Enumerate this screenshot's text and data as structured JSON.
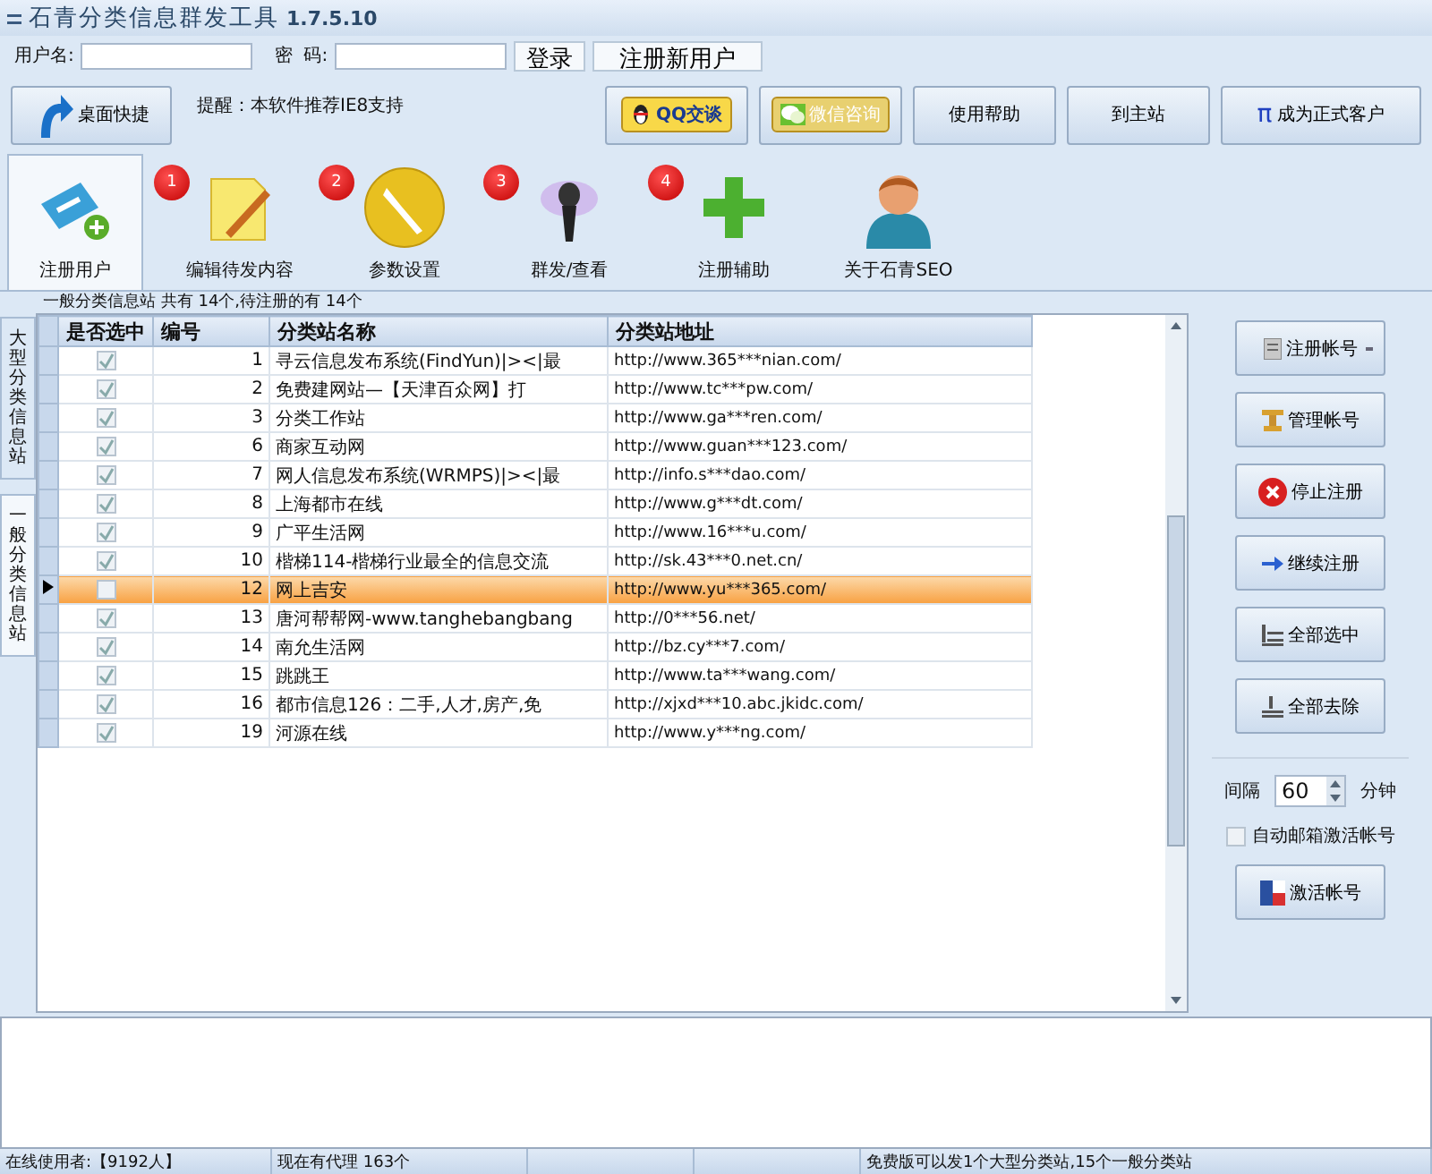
{
  "window": {
    "title": "石青分类信息群发工具",
    "version": "1.7.5.10"
  },
  "login": {
    "username_label": "用户名:",
    "password_label": "密  码:",
    "login_button": "登录",
    "register_button": "注册新用户"
  },
  "toolbar": {
    "shortcut_button": "桌面快捷",
    "notice": "提醒：本软件推荐IE8支持",
    "buttons": [
      {
        "kind": "qq",
        "label": "QQ交谈"
      },
      {
        "kind": "wechat",
        "label": "微信咨询"
      },
      {
        "kind": "plain",
        "label": "使用帮助"
      },
      {
        "kind": "plain",
        "label": "到主站"
      },
      {
        "kind": "pi",
        "icon_text": "π",
        "label": "成为正式客户"
      }
    ]
  },
  "tabs": [
    {
      "kind": "tag",
      "label": "注册用户",
      "selected": true
    },
    {
      "kind": "note",
      "label": "编辑待发内容",
      "selected": false,
      "badge": "1"
    },
    {
      "kind": "wrench",
      "label": "参数设置",
      "selected": false,
      "badge": "2"
    },
    {
      "kind": "mic",
      "label": "群发/查看",
      "selected": false,
      "badge": "3"
    },
    {
      "kind": "plus",
      "label": "注册辅助",
      "selected": false,
      "badge": "4"
    },
    {
      "kind": "person",
      "label": "关于石青SEO",
      "selected": false
    }
  ],
  "side_tabs": [
    {
      "label": "大型分类信息站",
      "selected": false
    },
    {
      "label": "一般分类信息站",
      "selected": true
    }
  ],
  "group_title": "一般分类信息站 共有 14个,待注册的有 14个",
  "table": {
    "columns": [
      "是否选中",
      "编号",
      "分类站名称",
      "分类站地址"
    ],
    "rows": [
      {
        "checked": true,
        "selected": false,
        "number": "1",
        "name": "寻云信息发布系统(FindYun)|><|最",
        "url": "http://www.365***nian.com/"
      },
      {
        "checked": true,
        "selected": false,
        "number": "2",
        "name": "免费建网站—【天津百众网】打",
        "url": "http://www.tc***pw.com/"
      },
      {
        "checked": true,
        "selected": false,
        "number": "3",
        "name": "分类工作站",
        "url": "http://www.ga***ren.com/"
      },
      {
        "checked": true,
        "selected": false,
        "number": "6",
        "name": "商家互动网",
        "url": "http://www.guan***123.com/"
      },
      {
        "checked": true,
        "selected": false,
        "number": "7",
        "name": "网人信息发布系统(WRMPS)|><|最",
        "url": "http://info.s***dao.com/"
      },
      {
        "checked": true,
        "selected": false,
        "number": "8",
        "name": "上海都市在线",
        "url": "http://www.g***dt.com/"
      },
      {
        "checked": true,
        "selected": false,
        "number": "9",
        "name": "广平生活网",
        "url": "http://www.16***u.com/"
      },
      {
        "checked": true,
        "selected": false,
        "number": "10",
        "name": "楷梯114-楷梯行业最全的信息交流",
        "url": "http://sk.43***0.net.cn/"
      },
      {
        "checked": false,
        "selected": true,
        "number": "12",
        "name": "网上吉安",
        "url": "http://www.yu***365.com/"
      },
      {
        "checked": true,
        "selected": false,
        "number": "13",
        "name": "唐河帮帮网-www.tanghebangbang",
        "url": "http://0***56.net/"
      },
      {
        "checked": true,
        "selected": false,
        "number": "14",
        "name": "南允生活网",
        "url": "http://bz.cy***7.com/"
      },
      {
        "checked": true,
        "selected": false,
        "number": "15",
        "name": "跳跳王",
        "url": "http://www.ta***wang.com/"
      },
      {
        "checked": true,
        "selected": false,
        "number": "16",
        "name": "都市信息126：二手,人才,房产,免",
        "url": "http://xjxd***10.abc.jkidc.com/"
      },
      {
        "checked": true,
        "selected": false,
        "number": "19",
        "name": "河源在线",
        "url": "http://www.y***ng.com/"
      }
    ]
  },
  "actions": [
    {
      "kind": "register",
      "label": "注册帐号",
      "dropdown": true
    },
    {
      "kind": "manage",
      "label": "管理帐号"
    },
    {
      "kind": "stop",
      "label": "停止注册"
    },
    {
      "kind": "continue",
      "label": "继续注册"
    },
    {
      "kind": "select_all",
      "label": "全部选中"
    },
    {
      "kind": "clear_all",
      "label": "全部去除"
    }
  ],
  "interval": {
    "label": "间隔",
    "value": "60",
    "unit": "分钟"
  },
  "auto_activate": {
    "label": "自动邮箱激活帐号",
    "checked": false
  },
  "activate_button": "激活帐号",
  "status_bar": [
    "在线使用者:【9192人】",
    "现在有代理 163个",
    "免费版可以发1个大型分类站,15个一般分类站"
  ]
}
